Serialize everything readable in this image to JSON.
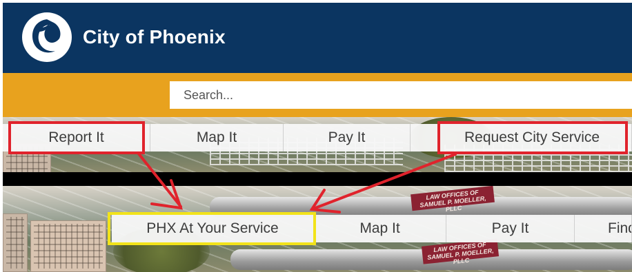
{
  "header": {
    "title": "City of Phoenix",
    "background_color": "#0b3561"
  },
  "search": {
    "placeholder": "Search...",
    "bar_color": "#e8a21e"
  },
  "old_nav": {
    "items": [
      {
        "label": "Report It"
      },
      {
        "label": "Map It"
      },
      {
        "label": "Pay It"
      },
      {
        "label": "Request City Service"
      }
    ]
  },
  "new_nav": {
    "items": [
      {
        "label": "PHX At Your Service"
      },
      {
        "label": "Map It"
      },
      {
        "label": "Pay It"
      },
      {
        "label": "Find"
      }
    ]
  },
  "background_sign": {
    "line1": "LAW OFFICES OF",
    "line2": "SAMUEL P. MOELLER, PLLC"
  },
  "annotations": {
    "arrow_color": "#e0232c",
    "highlight_new_color": "#f2e31a"
  }
}
